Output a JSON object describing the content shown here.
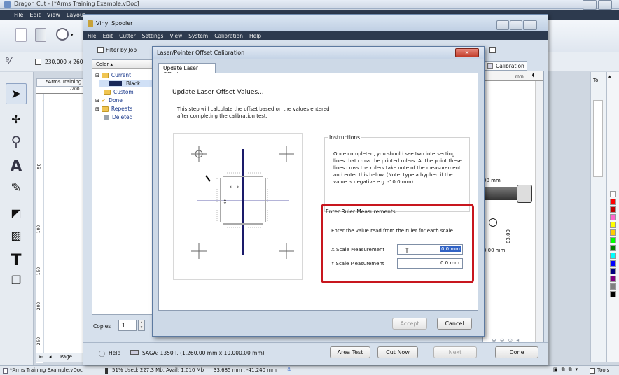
{
  "app": {
    "title": "Dragon Cut - [*Arms Training Example.vDoc]",
    "menu": [
      "File",
      "Edit",
      "View",
      "Layout"
    ],
    "size_value": "230.000 x 260.00",
    "doc_tab": "*Arms Training E",
    "ruler_200": "-200",
    "ruler_50": "50",
    "ruler_100": "100",
    "ruler_150": "150",
    "ruler_200v": "200",
    "ruler_250": "250",
    "mm_label": "mm",
    "page_label": "Page",
    "right_panel_label": "To",
    "tools_label": "Tools"
  },
  "status_bar": {
    "doc_name": "*Arms Training Example.vDoc",
    "memory": "51%  Used: 227.3 Mb, Avail: 1.010 Mb",
    "coords": "33.685 mm , -41.240 mm"
  },
  "spooler": {
    "title": "Vinyl Spooler",
    "menu": [
      "File",
      "Edit",
      "Cutter",
      "Settings",
      "View",
      "System",
      "Calibration",
      "Help"
    ],
    "filter_label": "Filter by Job",
    "color_column": "Color",
    "tree": [
      {
        "label": "Current",
        "indent": 0,
        "icon": "folder"
      },
      {
        "label": "Black",
        "indent": 2,
        "icon": "black-swatch",
        "selected": true
      },
      {
        "label": "Custom",
        "indent": 1,
        "icon": "folder"
      },
      {
        "label": "Done",
        "indent": 0,
        "icon": "check"
      },
      {
        "label": "Repeats",
        "indent": 0,
        "icon": "folder"
      },
      {
        "label": "Deleted",
        "indent": 1,
        "icon": "trash"
      }
    ],
    "copies_label": "Copies",
    "copies_value": "1",
    "calibration_tab": "Calibration",
    "dim_label_1": "00 mm",
    "dim_label_2": "3.00 mm",
    "dim_label_3": "83.00",
    "help_label": "Help",
    "saga_status": "SAGA: 1350 I,  (1.260.00 mm x 10.000.00 mm)",
    "area_test": "Area Test",
    "cut_now": "Cut Now",
    "next": "Next",
    "done": "Done"
  },
  "dialog": {
    "title": "Laser/Pointer Offset Calibration",
    "tab": "Update Laser Offset",
    "heading": "Update Laser Offset Values...",
    "intro": "This step will calculate the offset based on the values entered after completing the calibration test.",
    "instructions_title": "Instructions",
    "instructions": "Once completed, you should see two intersecting lines that cross the printed rulers. At the point these lines cross the rulers take note of the measurement and enter this below. (Note: type a hyphen if the value is negative e.g. -10.0 mm).",
    "measure_title": "Enter Ruler Measurements",
    "measure_text": "Enter the value read from the ruler for each scale.",
    "x_label": "X Scale Measurement",
    "x_value": "0.0 mm",
    "y_label": "Y Scale Measurement",
    "y_value": "0.0 mm",
    "accept": "Accept",
    "cancel": "Cancel",
    "highlight_color": "#c8161e"
  },
  "palette": [
    "#ffffff",
    "#ff0000",
    "#c00000",
    "#ff66cc",
    "#ffff00",
    "#ffcc00",
    "#00ff00",
    "#008000",
    "#00ffff",
    "#0000ff",
    "#000080",
    "#800080",
    "#808080",
    "#000000"
  ]
}
